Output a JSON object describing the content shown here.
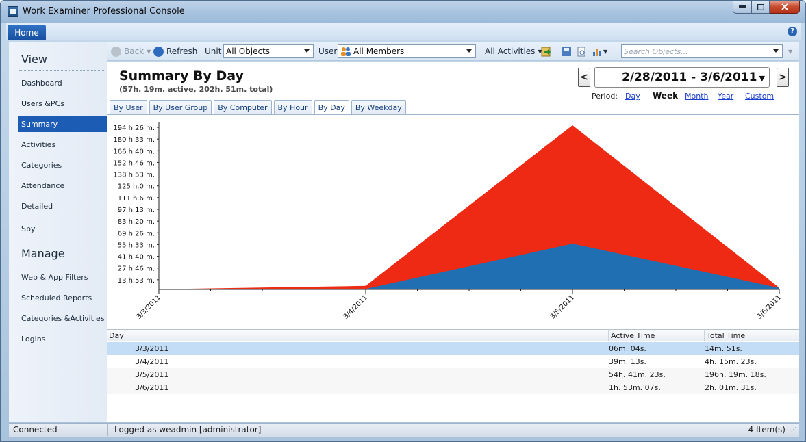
{
  "window": {
    "title": "Work Examiner Professional Console"
  },
  "ribbon": {
    "home_tab": "Home"
  },
  "nav": {
    "view_title": "View",
    "view_items": [
      "Dashboard",
      "Users &PCs",
      "Summary",
      "Activities",
      "Categories",
      "Attendance",
      "Detailed",
      "Spy"
    ],
    "manage_title": "Manage",
    "manage_items": [
      "Web & App Filters",
      "Scheduled Reports",
      "Categories &Activities",
      "Logins"
    ],
    "active": "Summary"
  },
  "toolbar": {
    "back": "Back",
    "refresh": "Refresh",
    "unit_label": "Unit",
    "unit_value": "All Objects",
    "user_label": "User",
    "user_value": "All Members",
    "activities": "All Activities",
    "search_placeholder": "Search Objects..."
  },
  "header": {
    "title": "Summary By Day",
    "subtitle": "(57h. 19m. active, 202h. 51m. total)",
    "prev": "<",
    "next": ">",
    "date_range": "2/28/2011 - 3/6/2011",
    "period_label": "Period:",
    "periods": [
      "Day",
      "Week",
      "Month",
      "Year",
      "Custom"
    ],
    "period_selected": "Week"
  },
  "tabs": [
    "By User",
    "By User Group",
    "By Computer",
    "By Hour",
    "By Day",
    "By Weekday"
  ],
  "active_tab": "By Day",
  "chart_data": {
    "type": "area",
    "x": [
      "3/3/2011",
      "3/4/2011",
      "3/5/2011",
      "3/6/2011"
    ],
    "y_tick_labels": [
      "194 h.26 m.",
      "180 h.33 m.",
      "166 h.40 m.",
      "152 h.46 m.",
      "138 h.53 m.",
      "125 h.0 m.",
      "111 h.6 m.",
      "97 h.13 m.",
      "83 h.20 m.",
      "69 h.26 m.",
      "55 h.33 m.",
      "41 h.40 m.",
      "27 h.46 m.",
      "13 h.53 m."
    ],
    "ylim": [
      0,
      196.32
    ],
    "series": [
      {
        "values": [
          0.247,
          4.256,
          196.322,
          2.025
        ],
        "color": "#ee2a14"
      },
      {
        "values": [
          0.101,
          0.654,
          54.69,
          1.885
        ],
        "color": "#1f6fb2"
      }
    ]
  },
  "table": {
    "columns": [
      "Day",
      "Active Time",
      "Total Time"
    ],
    "rows": [
      [
        "3/3/2011",
        "06m. 04s.",
        "14m. 51s."
      ],
      [
        "3/4/2011",
        "39m. 13s.",
        "4h. 15m. 23s."
      ],
      [
        "3/5/2011",
        "54h. 41m. 23s.",
        "196h. 19m. 18s."
      ],
      [
        "3/6/2011",
        "1h. 53m. 07s.",
        "2h. 01m. 31s."
      ]
    ]
  },
  "status": {
    "connection": "Connected",
    "login": "Logged as weadmin [administrator]",
    "items": "4 Item(s)"
  }
}
